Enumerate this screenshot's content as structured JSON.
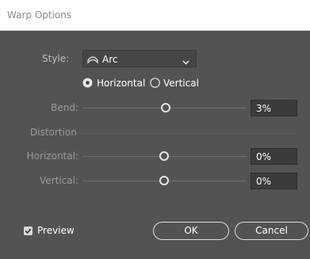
{
  "window": {
    "title": "Warp Options"
  },
  "style": {
    "label": "Style:",
    "selected": "Arc",
    "icon": "arc-warp-icon"
  },
  "orientation": {
    "options": [
      {
        "label": "Horizontal",
        "selected": true
      },
      {
        "label": "Vertical",
        "selected": false
      }
    ]
  },
  "bend": {
    "label": "Bend:",
    "value": "3%",
    "fraction": 0.53
  },
  "distortion": {
    "section_label": "Distortion",
    "horizontal": {
      "label": "Horizontal:",
      "value": "0%",
      "fraction": 0.5
    },
    "vertical": {
      "label": "Vertical:",
      "value": "0%",
      "fraction": 0.5
    }
  },
  "preview": {
    "label": "Preview",
    "checked": true
  },
  "buttons": {
    "ok": "OK",
    "cancel": "Cancel"
  },
  "colors": {
    "background": "#535353",
    "titlebar": "#ffffff",
    "field": "#3b3b3b"
  }
}
